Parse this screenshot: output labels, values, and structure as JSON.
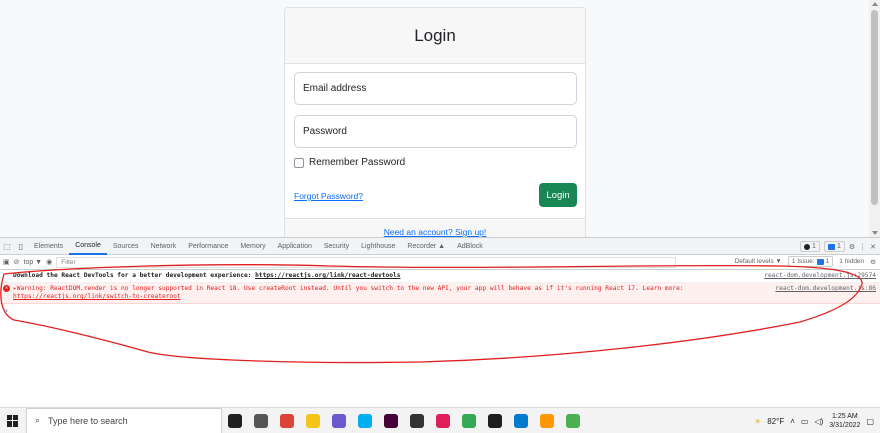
{
  "login": {
    "title": "Login",
    "email_placeholder": "Email address",
    "password_placeholder": "Password",
    "remember_label": "Remember Password",
    "forgot_link": "Forgot Password?",
    "login_button": "Login",
    "signup_link": "Need an account? Sign up!"
  },
  "devtools": {
    "tabs": [
      {
        "label": "Elements"
      },
      {
        "label": "Console"
      },
      {
        "label": "Sources"
      },
      {
        "label": "Network"
      },
      {
        "label": "Performance"
      },
      {
        "label": "Memory"
      },
      {
        "label": "Application"
      },
      {
        "label": "Security"
      },
      {
        "label": "Lighthouse"
      },
      {
        "label": "Recorder ▲"
      },
      {
        "label": "AdBlock"
      }
    ],
    "active_tab": "Console",
    "badge_errors": "1",
    "badge_issues": "1",
    "context": "top ▼",
    "filter_placeholder": "Filter",
    "levels": "Default levels ▼",
    "issues_label": "1 Issue:",
    "issues_count": "1",
    "hidden_label": "1 hidden",
    "logs": [
      {
        "type": "info",
        "message": "Download the React DevTools for a better development experience: ",
        "link": "https://reactjs.org/link/react-devtools",
        "source": "react-dom.development.js:29574"
      },
      {
        "type": "error",
        "message": "▸Warning: ReactDOM.render is no longer supported in React 18. Use createRoot instead. Until you switch to the new API, your app will behave as if it's running React 17. Learn more: ",
        "link": "https://reactjs.org/link/switch-to-createroot",
        "source": "react-dom.development.js:86"
      }
    ],
    "prompt": "›"
  },
  "annotation_color": "#e02020",
  "taskbar": {
    "search_placeholder": "Type here to search",
    "apps": [
      {
        "name": "cortana-icon",
        "color": "#1f1f1f"
      },
      {
        "name": "task-view-icon",
        "color": "#555555"
      },
      {
        "name": "chrome-icon",
        "color": "#db4437"
      },
      {
        "name": "file-explorer-icon",
        "color": "#f5c518"
      },
      {
        "name": "visual-studio-icon",
        "color": "#6a5acd"
      },
      {
        "name": "skype-icon",
        "color": "#00aff0"
      },
      {
        "name": "adobe-xd-icon",
        "color": "#470137"
      },
      {
        "name": "sticky-notes-icon",
        "color": "#333333"
      },
      {
        "name": "slack-icon",
        "color": "#e01e5a"
      },
      {
        "name": "chrome-profile-icon",
        "color": "#34a853"
      },
      {
        "name": "terminal-icon",
        "color": "#1e1e1e"
      },
      {
        "name": "vscode-icon",
        "color": "#007acc"
      },
      {
        "name": "sublime-icon",
        "color": "#ff9800"
      },
      {
        "name": "photos-icon",
        "color": "#4caf50"
      }
    ],
    "weather": "82°F",
    "time": "1:25 AM",
    "date": "3/31/2022"
  }
}
